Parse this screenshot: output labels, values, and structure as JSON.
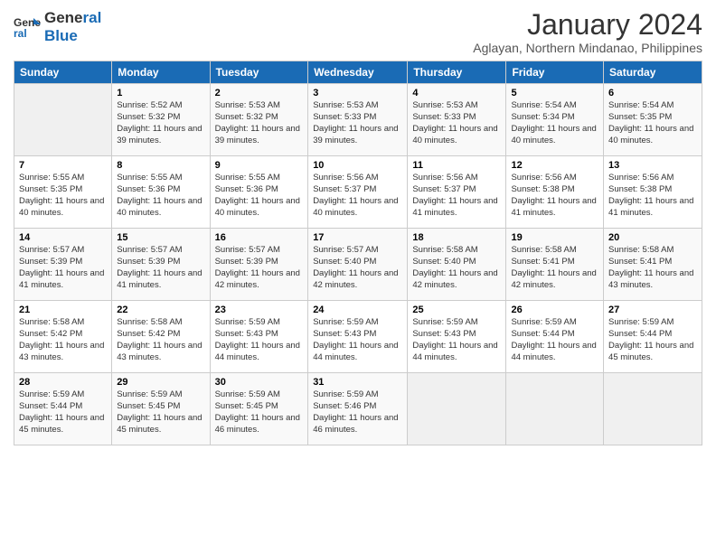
{
  "logo": {
    "line1": "General",
    "line2": "Blue"
  },
  "title": "January 2024",
  "subtitle": "Aglayan, Northern Mindanao, Philippines",
  "days_of_week": [
    "Sunday",
    "Monday",
    "Tuesday",
    "Wednesday",
    "Thursday",
    "Friday",
    "Saturday"
  ],
  "weeks": [
    [
      {
        "day": "",
        "sunrise": "",
        "sunset": "",
        "daylight": ""
      },
      {
        "day": "1",
        "sunrise": "Sunrise: 5:52 AM",
        "sunset": "Sunset: 5:32 PM",
        "daylight": "Daylight: 11 hours and 39 minutes."
      },
      {
        "day": "2",
        "sunrise": "Sunrise: 5:53 AM",
        "sunset": "Sunset: 5:32 PM",
        "daylight": "Daylight: 11 hours and 39 minutes."
      },
      {
        "day": "3",
        "sunrise": "Sunrise: 5:53 AM",
        "sunset": "Sunset: 5:33 PM",
        "daylight": "Daylight: 11 hours and 39 minutes."
      },
      {
        "day": "4",
        "sunrise": "Sunrise: 5:53 AM",
        "sunset": "Sunset: 5:33 PM",
        "daylight": "Daylight: 11 hours and 40 minutes."
      },
      {
        "day": "5",
        "sunrise": "Sunrise: 5:54 AM",
        "sunset": "Sunset: 5:34 PM",
        "daylight": "Daylight: 11 hours and 40 minutes."
      },
      {
        "day": "6",
        "sunrise": "Sunrise: 5:54 AM",
        "sunset": "Sunset: 5:35 PM",
        "daylight": "Daylight: 11 hours and 40 minutes."
      }
    ],
    [
      {
        "day": "7",
        "sunrise": "Sunrise: 5:55 AM",
        "sunset": "Sunset: 5:35 PM",
        "daylight": "Daylight: 11 hours and 40 minutes."
      },
      {
        "day": "8",
        "sunrise": "Sunrise: 5:55 AM",
        "sunset": "Sunset: 5:36 PM",
        "daylight": "Daylight: 11 hours and 40 minutes."
      },
      {
        "day": "9",
        "sunrise": "Sunrise: 5:55 AM",
        "sunset": "Sunset: 5:36 PM",
        "daylight": "Daylight: 11 hours and 40 minutes."
      },
      {
        "day": "10",
        "sunrise": "Sunrise: 5:56 AM",
        "sunset": "Sunset: 5:37 PM",
        "daylight": "Daylight: 11 hours and 40 minutes."
      },
      {
        "day": "11",
        "sunrise": "Sunrise: 5:56 AM",
        "sunset": "Sunset: 5:37 PM",
        "daylight": "Daylight: 11 hours and 41 minutes."
      },
      {
        "day": "12",
        "sunrise": "Sunrise: 5:56 AM",
        "sunset": "Sunset: 5:38 PM",
        "daylight": "Daylight: 11 hours and 41 minutes."
      },
      {
        "day": "13",
        "sunrise": "Sunrise: 5:56 AM",
        "sunset": "Sunset: 5:38 PM",
        "daylight": "Daylight: 11 hours and 41 minutes."
      }
    ],
    [
      {
        "day": "14",
        "sunrise": "Sunrise: 5:57 AM",
        "sunset": "Sunset: 5:39 PM",
        "daylight": "Daylight: 11 hours and 41 minutes."
      },
      {
        "day": "15",
        "sunrise": "Sunrise: 5:57 AM",
        "sunset": "Sunset: 5:39 PM",
        "daylight": "Daylight: 11 hours and 41 minutes."
      },
      {
        "day": "16",
        "sunrise": "Sunrise: 5:57 AM",
        "sunset": "Sunset: 5:39 PM",
        "daylight": "Daylight: 11 hours and 42 minutes."
      },
      {
        "day": "17",
        "sunrise": "Sunrise: 5:57 AM",
        "sunset": "Sunset: 5:40 PM",
        "daylight": "Daylight: 11 hours and 42 minutes."
      },
      {
        "day": "18",
        "sunrise": "Sunrise: 5:58 AM",
        "sunset": "Sunset: 5:40 PM",
        "daylight": "Daylight: 11 hours and 42 minutes."
      },
      {
        "day": "19",
        "sunrise": "Sunrise: 5:58 AM",
        "sunset": "Sunset: 5:41 PM",
        "daylight": "Daylight: 11 hours and 42 minutes."
      },
      {
        "day": "20",
        "sunrise": "Sunrise: 5:58 AM",
        "sunset": "Sunset: 5:41 PM",
        "daylight": "Daylight: 11 hours and 43 minutes."
      }
    ],
    [
      {
        "day": "21",
        "sunrise": "Sunrise: 5:58 AM",
        "sunset": "Sunset: 5:42 PM",
        "daylight": "Daylight: 11 hours and 43 minutes."
      },
      {
        "day": "22",
        "sunrise": "Sunrise: 5:58 AM",
        "sunset": "Sunset: 5:42 PM",
        "daylight": "Daylight: 11 hours and 43 minutes."
      },
      {
        "day": "23",
        "sunrise": "Sunrise: 5:59 AM",
        "sunset": "Sunset: 5:43 PM",
        "daylight": "Daylight: 11 hours and 44 minutes."
      },
      {
        "day": "24",
        "sunrise": "Sunrise: 5:59 AM",
        "sunset": "Sunset: 5:43 PM",
        "daylight": "Daylight: 11 hours and 44 minutes."
      },
      {
        "day": "25",
        "sunrise": "Sunrise: 5:59 AM",
        "sunset": "Sunset: 5:43 PM",
        "daylight": "Daylight: 11 hours and 44 minutes."
      },
      {
        "day": "26",
        "sunrise": "Sunrise: 5:59 AM",
        "sunset": "Sunset: 5:44 PM",
        "daylight": "Daylight: 11 hours and 44 minutes."
      },
      {
        "day": "27",
        "sunrise": "Sunrise: 5:59 AM",
        "sunset": "Sunset: 5:44 PM",
        "daylight": "Daylight: 11 hours and 45 minutes."
      }
    ],
    [
      {
        "day": "28",
        "sunrise": "Sunrise: 5:59 AM",
        "sunset": "Sunset: 5:44 PM",
        "daylight": "Daylight: 11 hours and 45 minutes."
      },
      {
        "day": "29",
        "sunrise": "Sunrise: 5:59 AM",
        "sunset": "Sunset: 5:45 PM",
        "daylight": "Daylight: 11 hours and 45 minutes."
      },
      {
        "day": "30",
        "sunrise": "Sunrise: 5:59 AM",
        "sunset": "Sunset: 5:45 PM",
        "daylight": "Daylight: 11 hours and 46 minutes."
      },
      {
        "day": "31",
        "sunrise": "Sunrise: 5:59 AM",
        "sunset": "Sunset: 5:46 PM",
        "daylight": "Daylight: 11 hours and 46 minutes."
      },
      {
        "day": "",
        "sunrise": "",
        "sunset": "",
        "daylight": ""
      },
      {
        "day": "",
        "sunrise": "",
        "sunset": "",
        "daylight": ""
      },
      {
        "day": "",
        "sunrise": "",
        "sunset": "",
        "daylight": ""
      }
    ]
  ]
}
